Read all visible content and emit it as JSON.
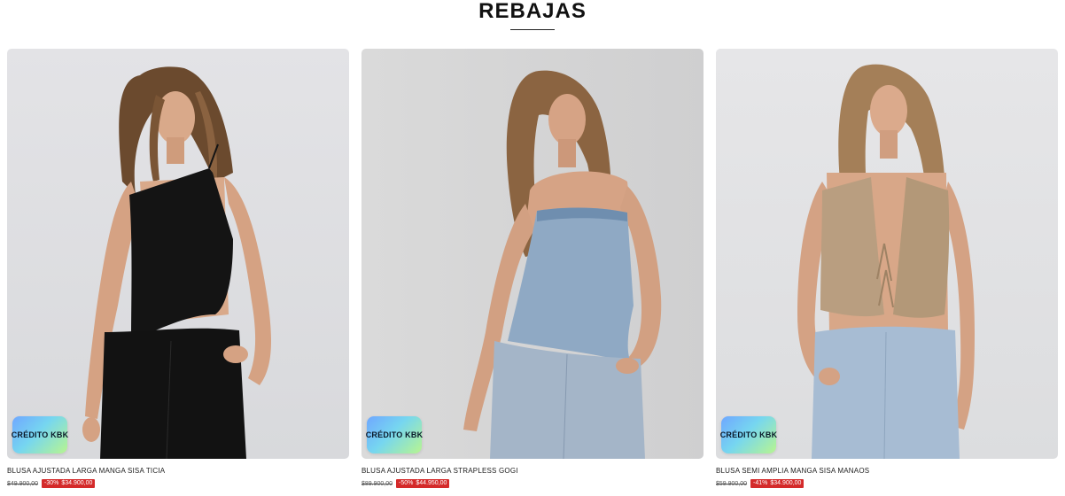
{
  "section": {
    "title": "REBAJAS"
  },
  "products": [
    {
      "name": "BLUSA AJUSTADA LARGA MANGA SISA TICIA",
      "old_price": "$49.900,00",
      "discount": "-30%",
      "sale_price": "$34.900,00",
      "badge": "CRÉDITO KBK",
      "garment": "black asymmetric one-shoulder top, black jeans"
    },
    {
      "name": "BLUSA AJUSTADA LARGA STRAPLESS GOGI",
      "old_price": "$89.900,00",
      "discount": "-50%",
      "sale_price": "$44.950,00",
      "badge": "CRÉDITO KBK",
      "garment": "denim strapless top, light blue jeans"
    },
    {
      "name": "BLUSA SEMI AMPLIA MANGA SISA MANAOS",
      "old_price": "$59.900,00",
      "discount": "-41%",
      "sale_price": "$34.900,00",
      "badge": "CRÉDITO KBK",
      "garment": "beige knit tie-front vest, light blue jeans"
    }
  ],
  "colors": {
    "discount_tag": "#d42a2a",
    "title_text": "#111111",
    "background": "#ffffff"
  }
}
